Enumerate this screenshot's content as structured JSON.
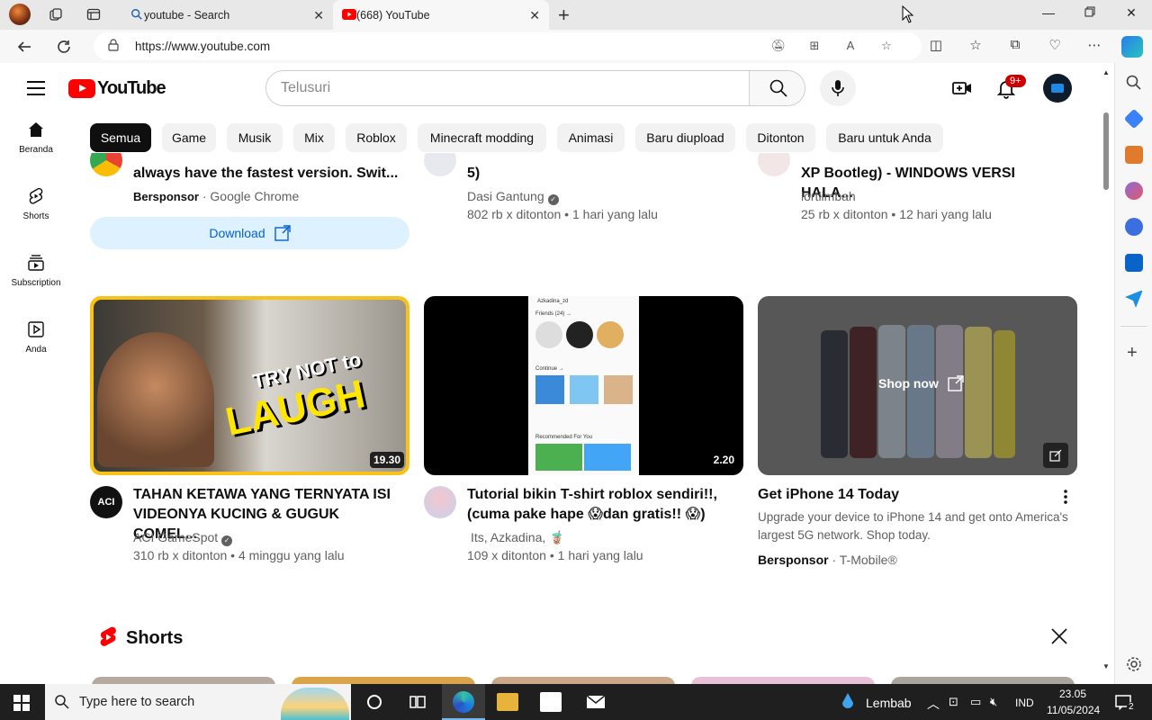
{
  "browser": {
    "tabs": [
      {
        "title": "youtube - Search"
      },
      {
        "title": "(668) YouTube"
      }
    ],
    "url": "https://www.youtube.com"
  },
  "yt": {
    "logo_text": "YouTube",
    "search_placeholder": "Telusuri",
    "notif_count": "9+",
    "guide": [
      {
        "label": "Beranda",
        "icon": "home-icon"
      },
      {
        "label": "Shorts",
        "icon": "shorts-icon"
      },
      {
        "label": "Subscription",
        "icon": "subscriptions-icon"
      },
      {
        "label": "Anda",
        "icon": "you-icon"
      }
    ],
    "chips": [
      "Semua",
      "Game",
      "Musik",
      "Mix",
      "Roblox",
      "Minecraft modding",
      "Animasi",
      "Baru diupload",
      "Ditonton",
      "Baru untuk Anda"
    ],
    "row1": [
      {
        "title": "always have the fastest version. Swit...",
        "sponsor_label": "Bersponsor",
        "channel": "Google Chrome",
        "button": "Download"
      },
      {
        "title": "5)",
        "channel": "Dasi Gantung",
        "meta": "802 rb x ditonton • 1 hari yang lalu"
      },
      {
        "title": "XP Bootleg) - WINDOWS VERSI HALA...",
        "channel": "lortlimbah",
        "meta": "25 rb x ditonton • 12 hari yang lalu"
      }
    ],
    "row2": [
      {
        "title_line1": "TAHAN KETAWA YANG TERNYATA ISI",
        "title_line2": "VIDEONYA KUCING & GUGUK COMEL...",
        "channel": "ACI GameSpot",
        "meta": "310 rb x ditonton • 4 minggu yang lalu",
        "duration": "19.30",
        "thumb_text_1": "TRY NOT to",
        "thumb_text_2": "LAUGH",
        "avatar_text": "ACI"
      },
      {
        "title_line1": "Tutorial bikin T-shirt roblox sendiri!!,",
        "title_line2": "(cuma pake hape 😱dan gratis!! 😱)",
        "channel": "Its, Azkadina, 🧋",
        "meta": "109 x ditonton • 1 hari yang lalu",
        "duration": "2.20",
        "phone_header": "Azkadina_zd",
        "phone_friends": "Friends (24) →",
        "phone_continue": "Continue →",
        "phone_recommended": "Recommended For You"
      },
      {
        "title": "Get iPhone 14 Today",
        "desc_line1": "Upgrade your device to iPhone 14 and get onto America's",
        "desc_line2": "largest 5G network. Shop today.",
        "sponsor_label": "Bersponsor",
        "advertiser": "T-Mobile®",
        "overlay_button": "Shop now"
      }
    ],
    "shorts_title": "Shorts"
  },
  "taskbar": {
    "search_placeholder": "Type here to search",
    "weather": "Lembab",
    "lang": "IND",
    "time": "23.05",
    "date": "11/05/2024",
    "notif_count": "2"
  },
  "colors": {
    "yt_red": "#ff0000",
    "link_blue": "#065fd4",
    "chip_active": "#0f0f0f",
    "taskbar": "#1f1f1f"
  }
}
